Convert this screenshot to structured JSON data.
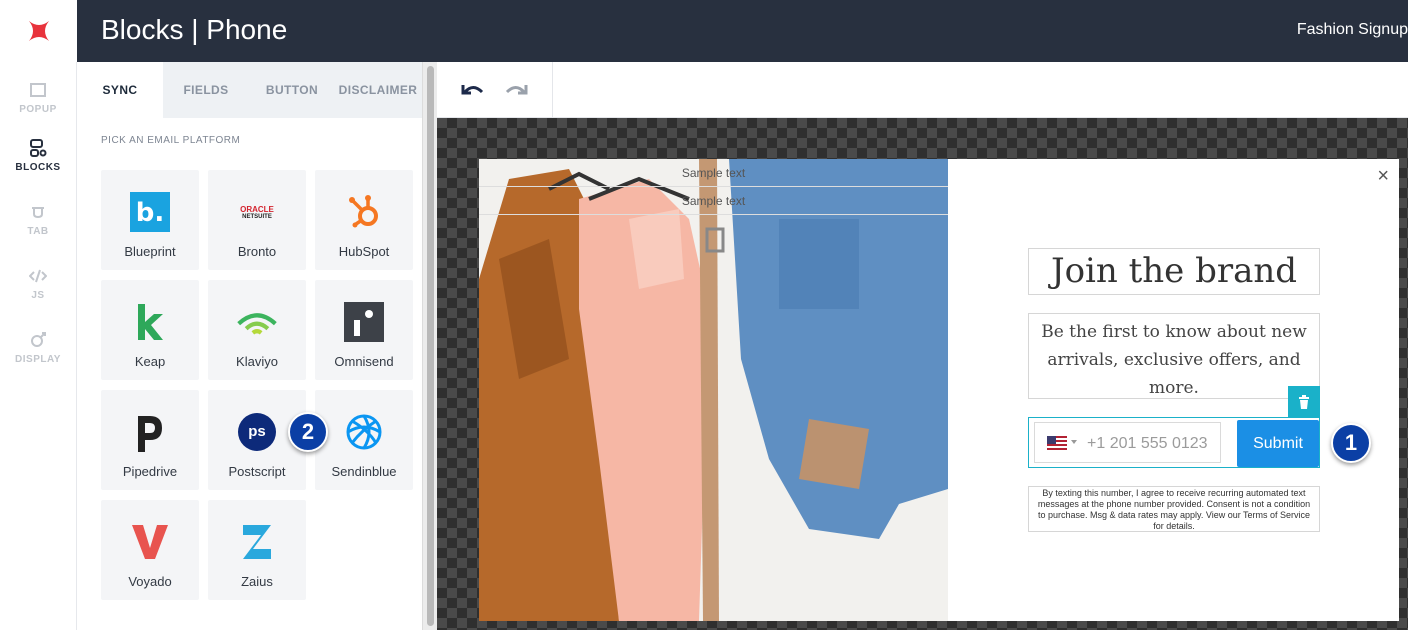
{
  "header": {
    "title": "Blocks | Phone",
    "campaign_name": "Fashion Signup"
  },
  "rail": {
    "items": [
      {
        "label": "POPUP",
        "icon": "popup-icon"
      },
      {
        "label": "BLOCKS",
        "icon": "blocks-icon"
      },
      {
        "label": "TAB",
        "icon": "tab-icon"
      },
      {
        "label": "JS",
        "icon": "code-icon"
      },
      {
        "label": "DISPLAY",
        "icon": "display-icon"
      }
    ],
    "active": "BLOCKS"
  },
  "panel": {
    "tabs": [
      "SYNC",
      "FIELDS",
      "BUTTON",
      "DISCLAIMER"
    ],
    "active_tab": "SYNC",
    "section_label": "PICK AN EMAIL PLATFORM",
    "platforms": [
      "Blueprint",
      "Bronto",
      "HubSpot",
      "Keap",
      "Klaviyo",
      "Omnisend",
      "Pipedrive",
      "Postscript",
      "Sendinblue",
      "Voyado",
      "Zaius"
    ],
    "bronto_logo_text": [
      "ORACLE",
      "NETSUITE"
    ],
    "postscript_logo_text": "ps"
  },
  "popup": {
    "sample_texts": [
      "Sample text",
      "Sample text"
    ],
    "headline": "Join the brand",
    "subheadline": "Be the first to know about new arrivals, exclusive offers, and more.",
    "phone_placeholder": "+1 201 555 0123",
    "submit_label": "Submit",
    "disclaimer": "By texting this number, I agree to receive recurring automated text messages at the phone number provided. Consent is not a condition to purchase. Msg & data rates may apply. View our Terms of Service for details.",
    "close_symbol": "×"
  },
  "markers": [
    "1",
    "2"
  ],
  "colors": {
    "header_bg": "#28303f",
    "accent_teal": "#1ab1c9",
    "submit_blue": "#1b8fe5",
    "marker_blue": "#0b3fa5"
  }
}
